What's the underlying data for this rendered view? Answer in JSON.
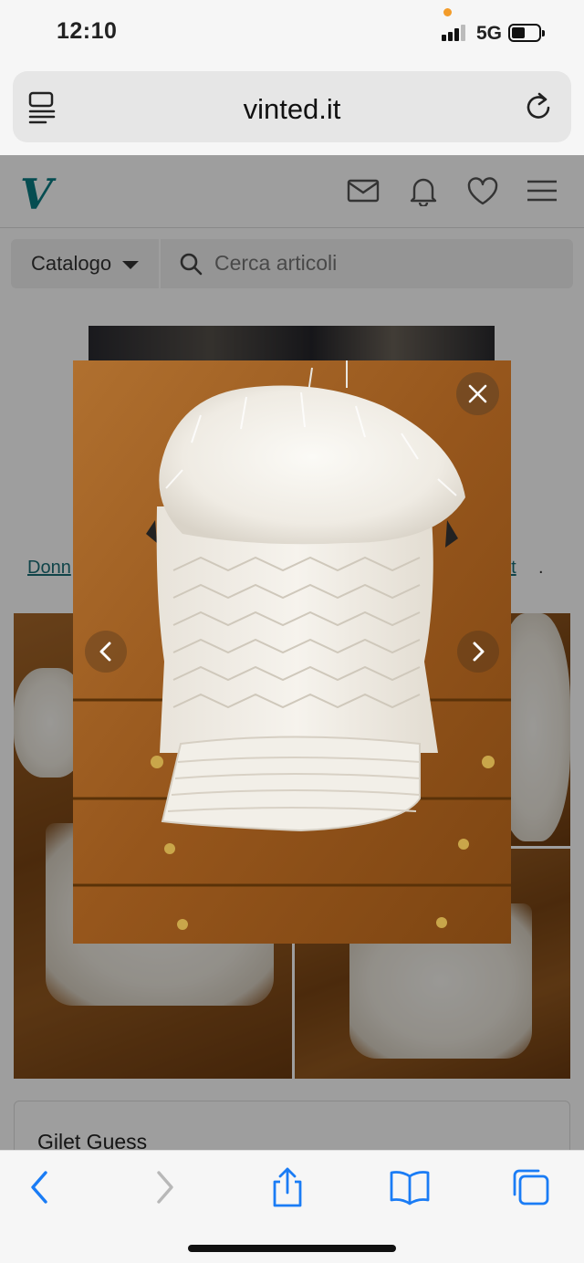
{
  "status_bar": {
    "time": "12:10",
    "network": "5G"
  },
  "browser": {
    "url": "vinted.it"
  },
  "site": {
    "logo": "V",
    "catalog_label": "Catalogo",
    "search_placeholder": "Cerca articoli",
    "breadcrumb_left": "Donn",
    "breadcrumb_right": "et",
    "breadcrumb_trailing": ".",
    "item_title": "Gilet Guess"
  },
  "colors": {
    "brand": "#0a7c83",
    "link": "#1b6f76",
    "ios_blue": "#1a7cf5"
  },
  "icons": [
    "tabs-icon",
    "reload-icon",
    "mail-icon",
    "bell-icon",
    "heart-icon",
    "menu-icon",
    "search-icon",
    "close-icon",
    "chevron-left-icon",
    "chevron-right-icon",
    "share-icon",
    "bookmarks-icon",
    "tabs-overview-icon"
  ]
}
